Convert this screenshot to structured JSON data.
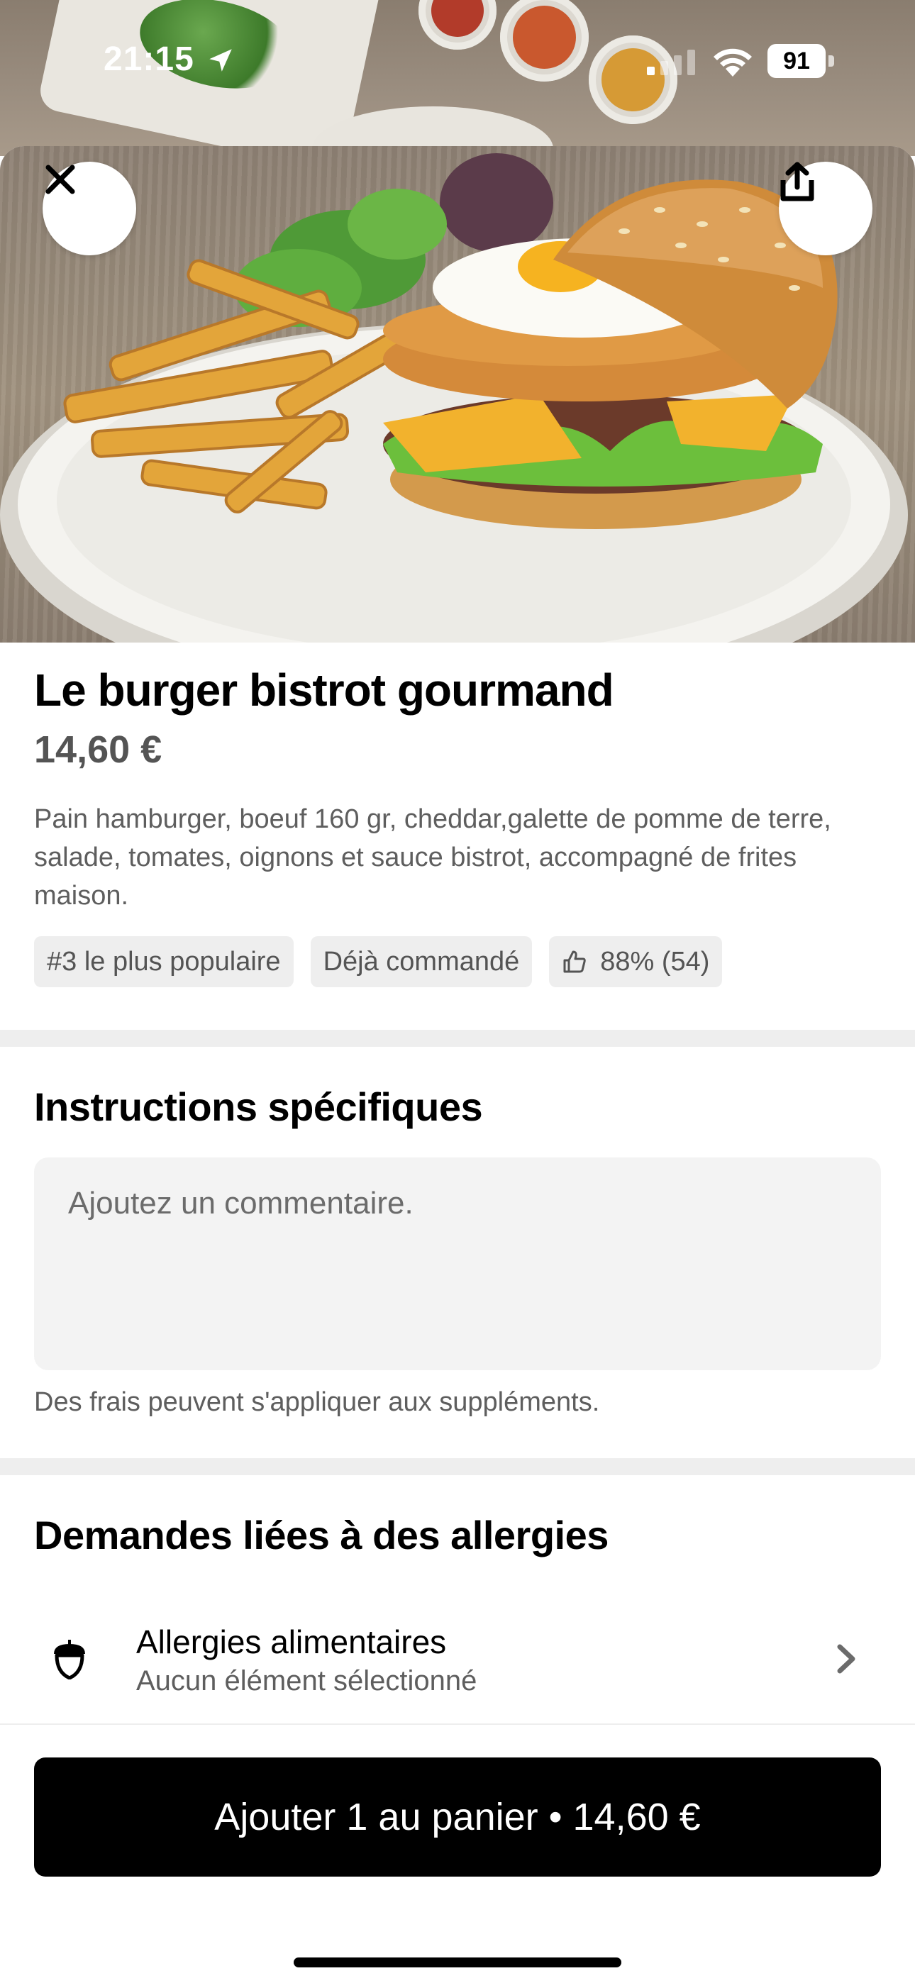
{
  "status_bar": {
    "time": "21:15",
    "battery": "91",
    "icons": [
      "location-arrow-icon",
      "cellular-signal-icon",
      "wifi-icon",
      "battery-icon"
    ]
  },
  "header": {
    "close_icon": "close-icon",
    "share_icon": "share-icon"
  },
  "item": {
    "title": "Le burger bistrot gourmand",
    "price": "14,60 €",
    "description": "Pain hamburger, boeuf 160 gr, cheddar,galette de pomme de terre, salade, tomates, oignons et sauce bistrot, accompagné de frites maison.",
    "tags": [
      {
        "label": "#3 le plus populaire"
      },
      {
        "label": "Déjà commandé"
      },
      {
        "label": "88% (54)",
        "icon": "thumbs-up-icon"
      }
    ]
  },
  "instructions": {
    "title": "Instructions spécifiques",
    "placeholder": "Ajoutez un commentaire.",
    "value": "",
    "note": "Des frais peuvent s'appliquer aux suppléments."
  },
  "allergies": {
    "title": "Demandes liées à des allergies",
    "row_title": "Allergies alimentaires",
    "row_subtitle": "Aucun élément sélectionné",
    "row_icon": "acorn-icon",
    "row_chevron": "chevron-right-icon"
  },
  "cta": {
    "label": "Ajouter 1 au panier • 14,60 €"
  },
  "colors": {
    "cta_background": "#000000",
    "tag_background": "#eeeeee",
    "divider": "#eeeeee",
    "input_background": "#f3f3f3",
    "secondary_text": "#5e5e5e"
  }
}
